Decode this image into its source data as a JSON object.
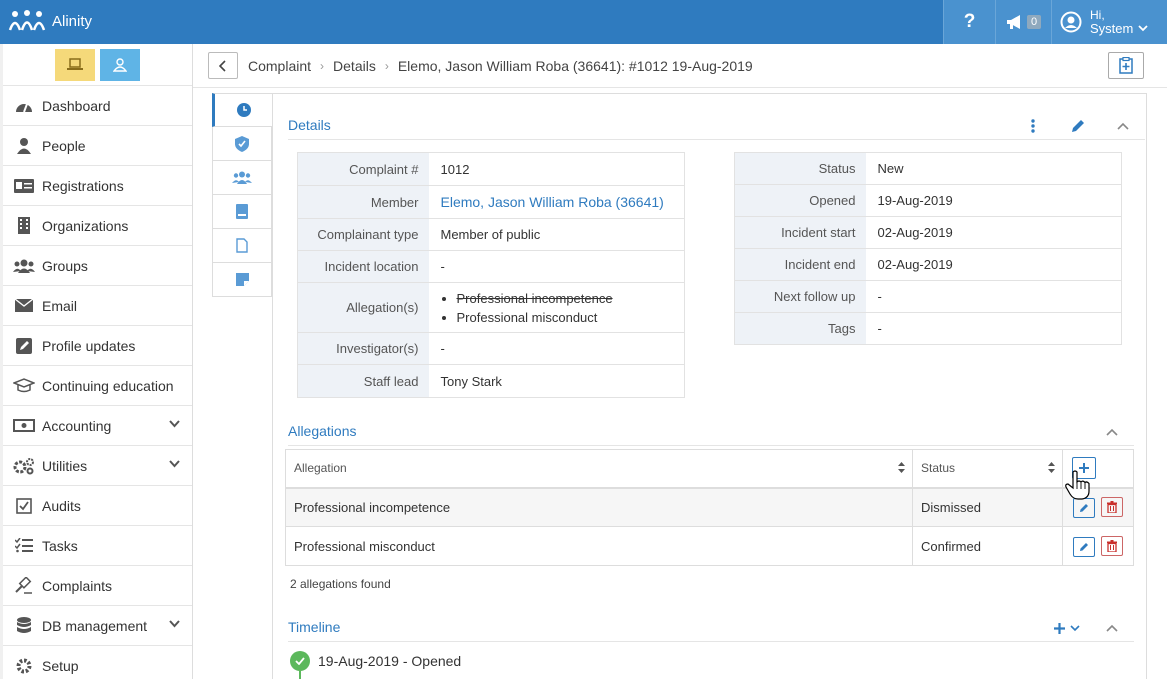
{
  "app": {
    "name": "Alinity"
  },
  "topbar": {
    "help_label": "?",
    "notification_count": "0",
    "user_greeting": "Hi,",
    "user_name": "System"
  },
  "sidebar": {
    "items": [
      {
        "label": "Dashboard",
        "icon": "dashboard-icon"
      },
      {
        "label": "People",
        "icon": "person-icon"
      },
      {
        "label": "Registrations",
        "icon": "id-card-icon"
      },
      {
        "label": "Organizations",
        "icon": "building-icon"
      },
      {
        "label": "Groups",
        "icon": "group-icon"
      },
      {
        "label": "Email",
        "icon": "envelope-icon"
      },
      {
        "label": "Profile updates",
        "icon": "edit-icon"
      },
      {
        "label": "Continuing education",
        "icon": "graduation-cap-icon"
      },
      {
        "label": "Accounting",
        "icon": "money-icon"
      },
      {
        "label": "Utilities",
        "icon": "gears-icon"
      },
      {
        "label": "Audits",
        "icon": "checkbox-icon"
      },
      {
        "label": "Tasks",
        "icon": "tasks-icon"
      },
      {
        "label": "Complaints",
        "icon": "gavel-icon"
      },
      {
        "label": "DB management",
        "icon": "database-icon"
      },
      {
        "label": "Setup",
        "icon": "gear-icon"
      }
    ]
  },
  "breadcrumb": {
    "items": [
      "Complaint",
      "Details",
      "Elemo, Jason William Roba (36641): #1012 19-Aug-2019"
    ]
  },
  "details": {
    "title": "Details",
    "left": {
      "complaint_no_label": "Complaint #",
      "complaint_no": "1012",
      "member_label": "Member",
      "member": "Elemo, Jason William Roba (36641)",
      "complainant_type_label": "Complainant type",
      "complainant_type": "Member of public",
      "incident_location_label": "Incident location",
      "incident_location": "-",
      "allegations_label": "Allegation(s)",
      "allegation_1": "Professional incompetence",
      "allegation_2": "Professional misconduct",
      "investigators_label": "Investigator(s)",
      "investigators": "-",
      "staff_lead_label": "Staff lead",
      "staff_lead": "Tony Stark"
    },
    "right": {
      "status_label": "Status",
      "status": "New",
      "opened_label": "Opened",
      "opened": "19-Aug-2019",
      "incident_start_label": "Incident start",
      "incident_start": "02-Aug-2019",
      "incident_end_label": "Incident end",
      "incident_end": "02-Aug-2019",
      "next_follow_up_label": "Next follow up",
      "next_follow_up": "-",
      "tags_label": "Tags",
      "tags": "-"
    }
  },
  "allegations": {
    "title": "Allegations",
    "columns": [
      "Allegation",
      "Status"
    ],
    "rows": [
      {
        "allegation": "Professional incompetence",
        "status": "Dismissed"
      },
      {
        "allegation": "Professional misconduct",
        "status": "Confirmed"
      }
    ],
    "found_text": "2 allegations found"
  },
  "timeline": {
    "title": "Timeline",
    "items": [
      {
        "text": "19-Aug-2019 - Opened"
      }
    ]
  },
  "colors": {
    "primary": "#2f7bbf",
    "success": "#5cb85c",
    "danger": "#c9302c"
  }
}
